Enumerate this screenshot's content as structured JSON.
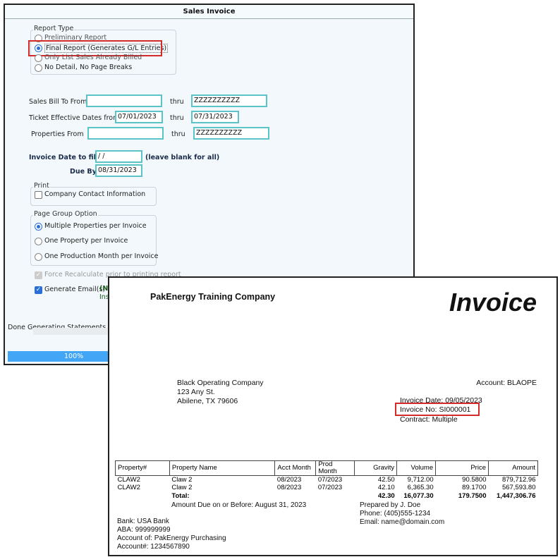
{
  "window": {
    "title": "Sales Invoice"
  },
  "report_type": {
    "legend": "Report Type",
    "options": [
      "Preliminary Report",
      "Final Report (Generates G/L Entries)",
      "Only List Sales Already Billed",
      "No Detail, No Page Breaks"
    ],
    "selected": 1
  },
  "filters": {
    "sales_bill_to_label": "Sales Bill To From",
    "sales_bill_to_from": "",
    "sales_bill_to_thru": "ZZZZZZZZZZ",
    "ticket_dates_label": "Ticket Effective Dates from",
    "ticket_from": "07/01/2023",
    "ticket_thru": "07/31/2023",
    "properties_label": "Properties From",
    "properties_from": "",
    "properties_thru": "ZZZZZZZZZZ",
    "thru_label": "thru",
    "invoice_date_label": "Invoice Date to filter",
    "invoice_date": " /  /",
    "invoice_date_hint": "(leave blank for all)",
    "due_by_label": "Due By",
    "due_by": "08/31/2023"
  },
  "print": {
    "legend": "Print",
    "company_contact": "Company Contact Information",
    "company_contact_checked": false
  },
  "page_group": {
    "legend": "Page Group Option",
    "options": [
      "Multiple Properties per Invoice",
      "One Property per Invoice",
      "One Production Month per Invoice"
    ],
    "selected": 0
  },
  "force_recalc": {
    "label": "Force Recalculate prior to printing report",
    "checked": true,
    "disabled": true
  },
  "generate_email": {
    "label": "Generate Email(s)",
    "note1": "(No",
    "note2": "Inst",
    "checked": true
  },
  "status": {
    "text": "Done Generating Statements",
    "progress_label": "100%",
    "progress": 100
  },
  "invoice": {
    "company": "PakEnergy Training Company",
    "title": "Invoice",
    "bill_to": [
      "Black Operating Company",
      "123 Any St.",
      "Abilene, TX  79606"
    ],
    "account": "Account:  BLAOPE",
    "invoice_date": "Invoice Date:  09/05/2023",
    "invoice_no": "Invoice No:  SI000001",
    "contract": "Contract:  Multiple",
    "columns": [
      "Property#",
      "Property Name",
      "Acct Month",
      "Prod Month",
      "Gravity",
      "Volume",
      "Price",
      "Amount"
    ],
    "rows": [
      [
        "CLAW2",
        "Claw 2",
        "08/2023",
        "07/2023",
        "42.50",
        "9,712.00",
        "90.5800",
        "879,712.96"
      ],
      [
        "CLAW2",
        "Claw 2",
        "08/2023",
        "07/2023",
        "42.10",
        "6,365.30",
        "89.1700",
        "567,593.80"
      ]
    ],
    "total": {
      "label": "Total:",
      "gravity": "42.30",
      "volume": "16,077.30",
      "price": "179.7500",
      "amount": "1,447,306.76"
    },
    "amount_due": "Amount Due on or Before: August 31, 2023",
    "prepared": [
      "Prepared by J. Doe",
      "Phone: (405)555-1234",
      "Email: name@domain.com"
    ],
    "bank": [
      "Bank: USA Bank",
      "ABA: 999999999",
      "Account of: PakEnergy Purchasing",
      "Account#: 1234567890"
    ]
  },
  "colors": {
    "highlight": "#d42a2a",
    "accent": "#2a6fd6",
    "input_border": "#5bc4c8",
    "progress": "#42a5f5"
  }
}
